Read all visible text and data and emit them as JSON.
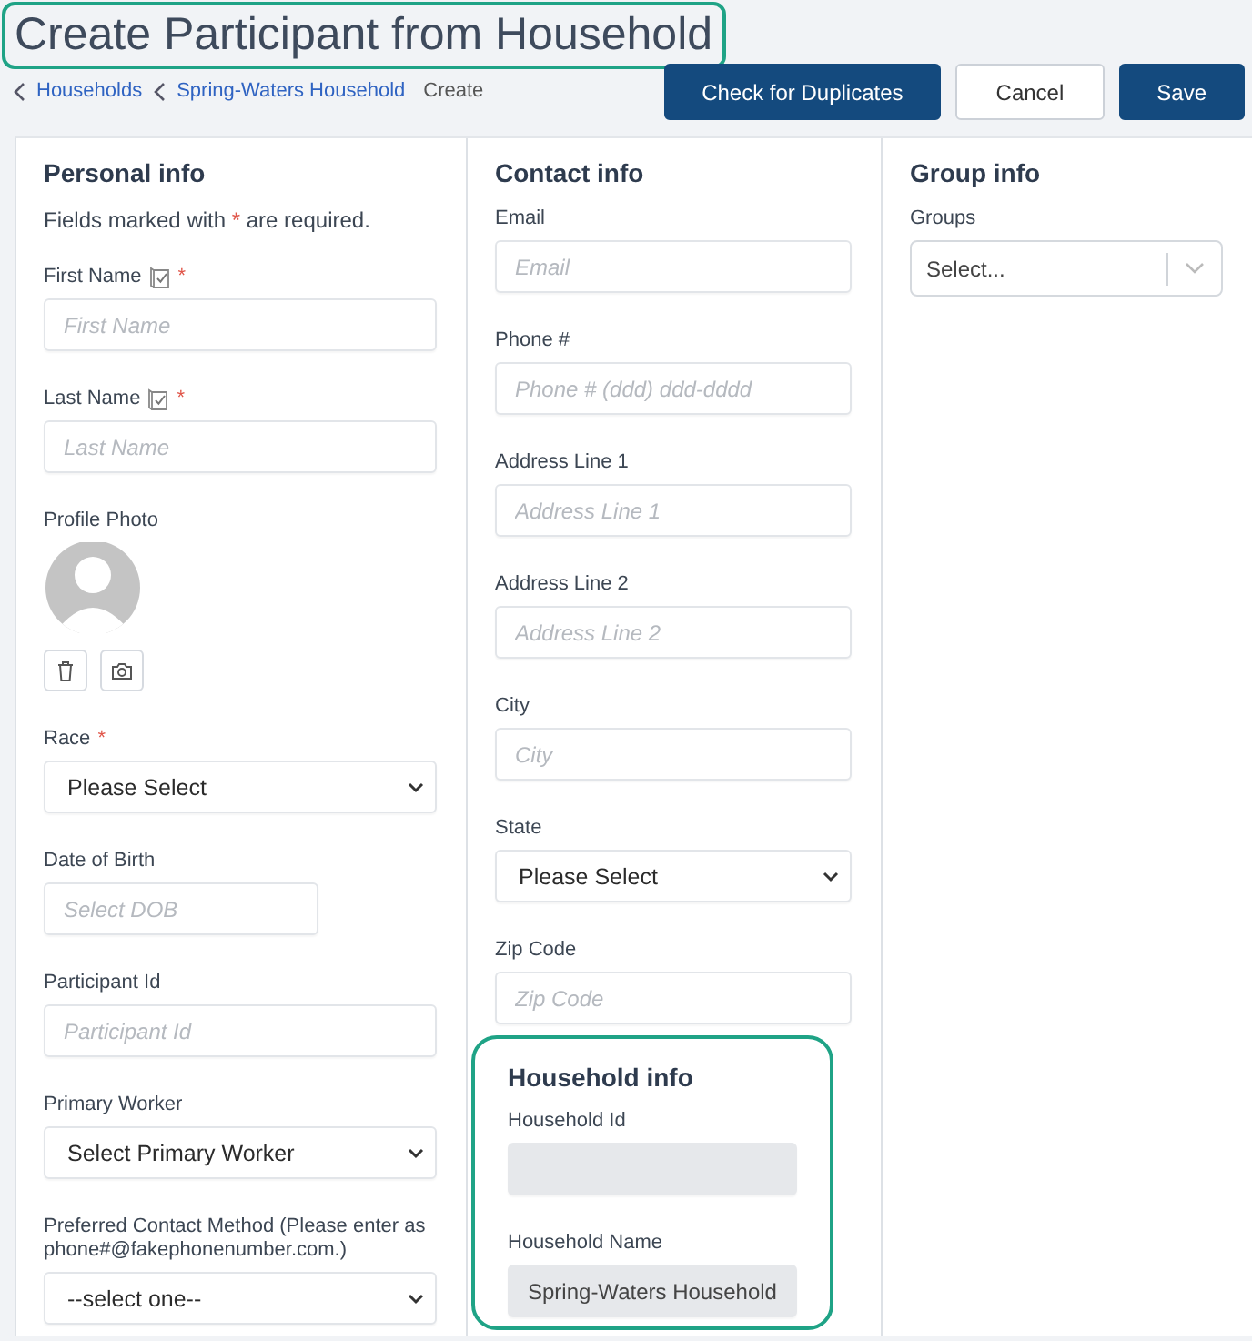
{
  "title": {
    "text": "Create Participant from Household",
    "highlighted": true
  },
  "breadcrumb": [
    {
      "label": "Households",
      "kind": "link"
    },
    {
      "label": "Spring-Waters Household",
      "kind": "link"
    },
    {
      "label": "Create",
      "kind": "current"
    }
  ],
  "buttons": [
    {
      "label": "Check for Duplicates",
      "kind": "primary"
    },
    {
      "label": "Cancel",
      "kind": "secondary"
    },
    {
      "label": "Save",
      "kind": "primary"
    }
  ],
  "columns": [
    {
      "sections": [
        {
          "heading": "Personal info",
          "note": {
            "before": "Fields marked with",
            "marker": "*",
            "after": "are required."
          },
          "highlighted": false,
          "fields": [
            {
              "kind": "text",
              "label": "First Name",
              "verify_icon": true,
              "required_mark": "*",
              "placeholder": "First Name"
            },
            {
              "kind": "text",
              "label": "Last Name",
              "verify_icon": true,
              "required_mark": "*",
              "placeholder": "Last Name"
            },
            {
              "kind": "photo",
              "label": "Profile Photo"
            },
            {
              "kind": "select",
              "label": "Race",
              "required_mark": "*",
              "value": "Please Select"
            },
            {
              "kind": "date",
              "label": "Date of Birth",
              "placeholder": "Select DOB"
            },
            {
              "kind": "text",
              "label": "Participant Id",
              "placeholder": "Participant Id"
            },
            {
              "kind": "select",
              "label": "Primary Worker",
              "value": "Select Primary Worker"
            },
            {
              "kind": "select",
              "label": "Preferred Contact Method (Please enter as phone#@fakephonenumber.com.)",
              "value": "--select one--"
            }
          ]
        }
      ]
    },
    {
      "sections": [
        {
          "heading": "Contact info",
          "highlighted": false,
          "fields": [
            {
              "kind": "text",
              "label": "Email",
              "placeholder": "Email"
            },
            {
              "kind": "text",
              "label": "Phone #",
              "placeholder": "Phone # (ddd) ddd-dddd"
            },
            {
              "kind": "text",
              "label": "Address Line 1",
              "placeholder": "Address Line 1"
            },
            {
              "kind": "text",
              "label": "Address Line 2",
              "placeholder": "Address Line 2"
            },
            {
              "kind": "text",
              "label": "City",
              "placeholder": "City"
            },
            {
              "kind": "select",
              "label": "State",
              "value": "Please Select"
            },
            {
              "kind": "text",
              "label": "Zip Code",
              "placeholder": "Zip Code"
            }
          ]
        },
        {
          "heading": "Household info",
          "highlighted": true,
          "fields": [
            {
              "kind": "readonly",
              "label": "Household Id"
            },
            {
              "kind": "readonly",
              "label": "Household Name",
              "value": "Spring-Waters Household"
            }
          ]
        }
      ]
    },
    {
      "sections": [
        {
          "heading": "Group info",
          "highlighted": false,
          "fields": [
            {
              "kind": "combo",
              "label": "Groups",
              "placeholder": "Select..."
            }
          ]
        }
      ]
    }
  ]
}
